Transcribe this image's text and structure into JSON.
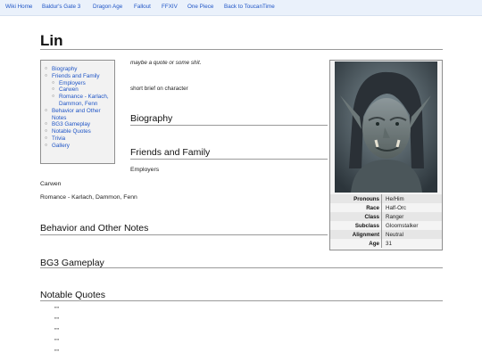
{
  "topnav": {
    "items": [
      "Wiki Home",
      "Baldur's Gate 3",
      "Dragon Age",
      "Fallout",
      "FFXIV",
      "One Piece",
      "Back to ToucanTime"
    ]
  },
  "page": {
    "title": "Lin",
    "quote": "maybe a quote or some shit.",
    "brief": "short brief on character"
  },
  "toc": {
    "items": [
      {
        "label": "Biography",
        "level": 1
      },
      {
        "label": "Friends and Family",
        "level": 1
      },
      {
        "label": "Employers",
        "level": 2
      },
      {
        "label": "Carwen",
        "level": 2
      },
      {
        "label": "Romance - Karlach, Dammon, Fenn",
        "level": 2
      },
      {
        "label": "Behavior and Other Notes",
        "level": 1
      },
      {
        "label": "BG3 Gameplay",
        "level": 1
      },
      {
        "label": "Notable Quotes",
        "level": 1
      },
      {
        "label": "Trivia",
        "level": 1
      },
      {
        "label": "Gallery",
        "level": 1
      }
    ]
  },
  "sections": {
    "biography": "Biography",
    "friends": "Friends and Family",
    "employers": "Employers",
    "carwen": "Carwen",
    "romance": "Romance - Karlach, Dammon, Fenn",
    "behavior": "Behavior and Other Notes",
    "gameplay": "BG3 Gameplay",
    "quotes": "Notable Quotes"
  },
  "infobox": {
    "rows": [
      {
        "key": "Pronouns",
        "value": "He/Him"
      },
      {
        "key": "Race",
        "value": "Half-Orc"
      },
      {
        "key": "Class",
        "value": "Ranger"
      },
      {
        "key": "Subclass",
        "value": "Gloomstalker"
      },
      {
        "key": "Alignment",
        "value": "Neutral"
      },
      {
        "key": "Age",
        "value": "31"
      }
    ]
  },
  "quotes_list": [
    "\"\"",
    "\"\"",
    "\"\"",
    "\"\"",
    "\"\""
  ]
}
